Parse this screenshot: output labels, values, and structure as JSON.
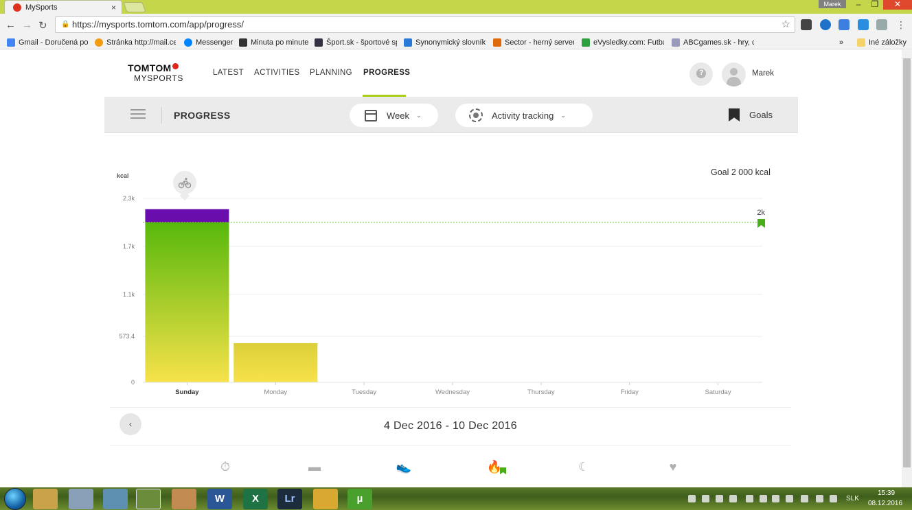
{
  "browser": {
    "tab_title": "MySports",
    "tab_close": "×",
    "user_badge": "Marek",
    "url": "https://mysports.tomtom.com/app/progress/",
    "bookmarks": [
      "Gmail - Doručená po",
      "Stránka http://mail.ce",
      "Messenger",
      "Minuta po minute",
      "Šport.sk - športové sp",
      "Synonymický slovník",
      "Sector - herný server,",
      "eVysledky.com: Futba",
      "ABCgames.sk - hry, ch"
    ],
    "bookmarks_more": "»",
    "other_bookmarks": "Iné záložky"
  },
  "app": {
    "logo_top": "TOMTOM",
    "logo_bottom": "MYSPORTS",
    "nav": [
      "LATEST",
      "ACTIVITIES",
      "PLANNING",
      "PROGRESS"
    ],
    "active_nav": "PROGRESS",
    "help_label": "?",
    "username": "Marek",
    "page_title": "PROGRESS",
    "period_select": "Week",
    "metric_select": "Activity tracking",
    "goals_label": "Goals"
  },
  "chart_data": {
    "type": "bar",
    "ylabel": "kcal",
    "goal_text": "Goal 2 000 kcal",
    "goal_value": 2000,
    "goal_label": "2k",
    "ylim": [
      0,
      2300
    ],
    "yticks": [
      0,
      573.4,
      1100,
      1700,
      2300
    ],
    "ytick_labels": [
      "0",
      "573.4",
      "1.1k",
      "1.7k",
      "2.3k"
    ],
    "categories": [
      "Sunday",
      "Monday",
      "Tuesday",
      "Wednesday",
      "Thursday",
      "Friday",
      "Saturday"
    ],
    "active_category": "Sunday",
    "series": [
      {
        "values": [
          2000,
          490,
          0,
          0,
          0,
          0,
          0
        ],
        "color": "gradient #f2e040 → #5cba0c"
      },
      {
        "values": [
          165,
          0,
          0,
          0,
          0,
          0,
          0
        ],
        "color": "#6a0dad"
      }
    ],
    "activity_icon": "bike-icon",
    "grid": true
  },
  "range": {
    "prev_label": "‹",
    "label": "4 Dec 2016 - 10 Dec 2016"
  },
  "stats": [
    {
      "icon": "stopwatch-icon",
      "glyph": "⏱"
    },
    {
      "icon": "ruler-icon",
      "glyph": "▬"
    },
    {
      "icon": "shoe-icon",
      "glyph": "👟"
    },
    {
      "icon": "flame-icon",
      "glyph": "🔥"
    },
    {
      "icon": "moon-icon",
      "glyph": "☾"
    },
    {
      "icon": "heart-icon",
      "glyph": "♥"
    }
  ],
  "taskbar": {
    "lang": "SLK",
    "time": "15:39",
    "date": "08.12.2016",
    "apps": [
      "",
      "",
      "",
      "",
      "",
      "W",
      "X",
      "Lr",
      "",
      "µ"
    ]
  }
}
